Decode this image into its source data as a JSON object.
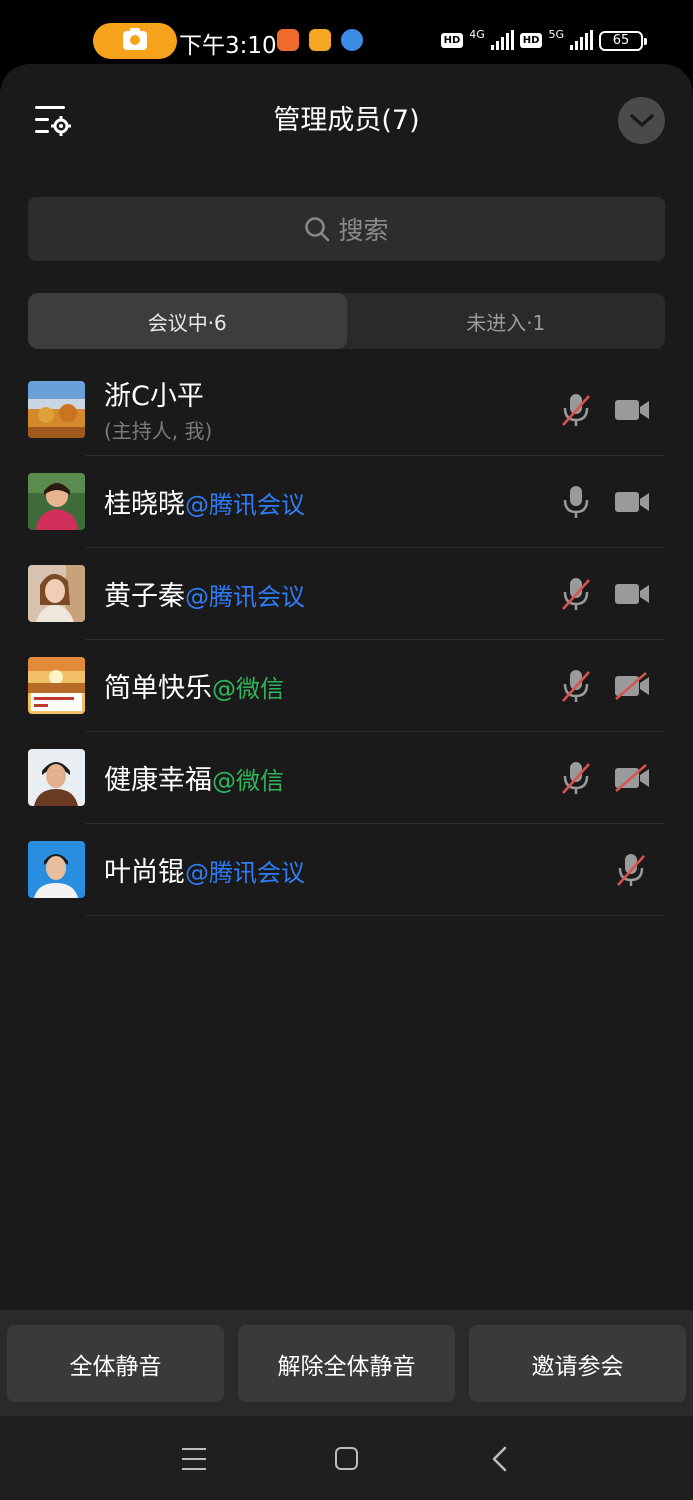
{
  "status_bar": {
    "time": "下午3:10",
    "network_1": "4G",
    "network_2": "5G",
    "hd_1": "HD",
    "hd_2": "HD",
    "battery": "65"
  },
  "header": {
    "title": "管理成员(7)"
  },
  "search": {
    "placeholder": "搜索"
  },
  "tabs": [
    {
      "label": "会议中·6",
      "active": true
    },
    {
      "label": "未进入·1",
      "active": false
    }
  ],
  "members": [
    {
      "name": "浙C小平",
      "suffix": "",
      "subtitle": "(主持人, 我)",
      "mic": "muted",
      "camera": "on"
    },
    {
      "name": "桂晓晓",
      "suffix": "@腾讯会议",
      "subtitle": "",
      "mic": "on",
      "camera": "on"
    },
    {
      "name": "黄子秦",
      "suffix": "@腾讯会议",
      "subtitle": "",
      "mic": "muted",
      "camera": "on"
    },
    {
      "name": "简单快乐",
      "suffix": "@微信",
      "subtitle": "",
      "mic": "muted",
      "camera": "off"
    },
    {
      "name": "健康幸福",
      "suffix": "@微信",
      "subtitle": "",
      "mic": "muted",
      "camera": "off"
    },
    {
      "name": "叶尚锟",
      "suffix": "@腾讯会议",
      "subtitle": "",
      "mic": "muted",
      "camera": "none"
    }
  ],
  "actions": {
    "mute_all": "全体静音",
    "unmute_all": "解除全体静音",
    "invite": "邀请参会"
  },
  "colors": {
    "tencent_meeting": "#2f7cf6",
    "wechat": "#2fb55a",
    "muted_slash": "#d9534f",
    "record_pill": "#f7a21b"
  }
}
